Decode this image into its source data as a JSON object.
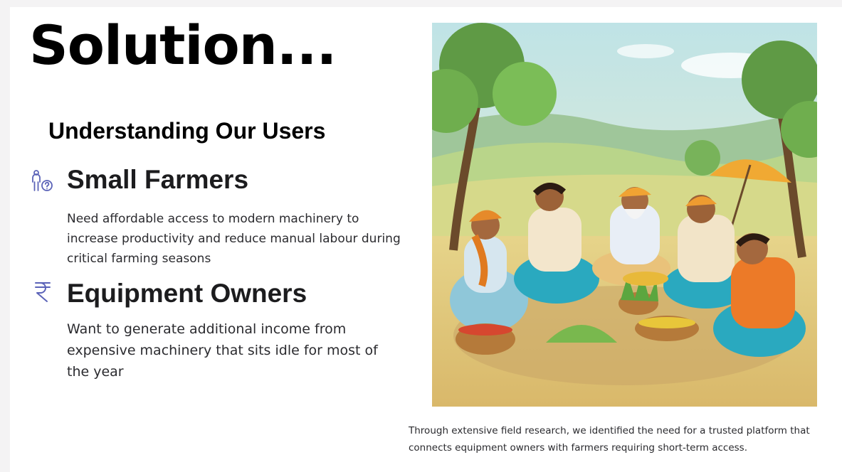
{
  "slide": {
    "title": "Solution...",
    "subtitle": "Understanding Our Users"
  },
  "users": [
    {
      "icon": "person-question-icon",
      "heading": "Small Farmers",
      "description": "Need affordable access to modern machinery to increase productivity and reduce manual labour during critical farming seasons"
    },
    {
      "icon": "rupee-icon",
      "heading": "Equipment Owners",
      "description": "Want to generate additional income from expensive machinery that sits idle for most of the year"
    }
  ],
  "illustration": {
    "subject": "farmers-gathering-illustration"
  },
  "caption": "Through extensive field research, we identified the need for a trusted platform that connects equipment owners with farmers requiring short-term access.",
  "colors": {
    "icon_accent": "#5b63b8",
    "page_bg": "#f4f3f4",
    "slide_bg": "#ffffff"
  }
}
